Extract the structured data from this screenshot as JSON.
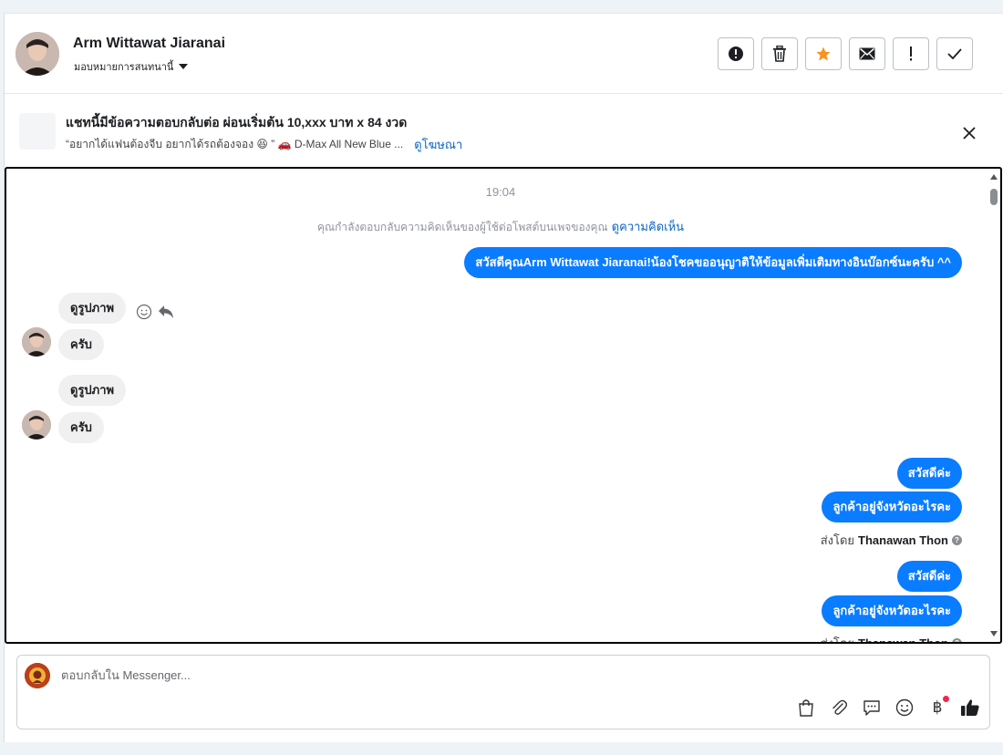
{
  "header": {
    "name": "Arm Wittawat Jiaranai",
    "assign_label": "มอบหมายการสนทนานี้",
    "actions": [
      "alert-icon",
      "trash-icon",
      "star-icon",
      "mail-icon",
      "exclamation-icon",
      "check-icon"
    ],
    "star_color": "#f7931e"
  },
  "ad": {
    "title": "แชทนี้มีข้อความตอบกลับต่อ ผ่อนเริ่มต้น 10,xxx บาท x 84 งวด",
    "subtitle": "“อยากได้แฟนต้องจีบ อยากได้รถต้องจอง 😆 ” 🚗 D-Max All New Blue ...",
    "link": "ดูโฆษณา"
  },
  "chat": {
    "time": "19:04",
    "system_text": "คุณกำลังตอบกลับความคิดเห็นของผู้ใช้ต่อโพสต์บนเพจของคุณ",
    "system_link": "ดูความคิดเห็น",
    "greeting": "สวัสดีคุณArm Wittawat Jiaranai!น้องโชคขออนุญาติให้ข้อมูลเพิ่มเติมทางอินบ๊อกซ์นะครับ ^^",
    "incoming": [
      {
        "image_label": "ดูรูปภาพ",
        "text": "ครับ"
      },
      {
        "image_label": "ดูรูปภาพ",
        "text": "ครับ"
      }
    ],
    "outgoing_groups": [
      {
        "messages": [
          "สวัสดีค่ะ",
          "ลูกค้าอยู่จังหวัดอะไรคะ"
        ],
        "sent_by_prefix": "ส่งโดย",
        "sent_by_name": "Thanawan Thon"
      },
      {
        "messages": [
          "สวัสดีค่ะ",
          "ลูกค้าอยู่จังหวัดอะไรคะ"
        ],
        "sent_by_prefix": "ส่งโดย",
        "sent_by_name": "Thanawan Thon"
      }
    ],
    "accent_color": "#0a7cff"
  },
  "composer": {
    "placeholder": "ตอบกลับใน Messenger...",
    "tools": [
      "bag-icon",
      "paperclip-icon",
      "saved-reply-icon",
      "emoji-icon",
      "baht-icon",
      "like-icon"
    ],
    "baht_symbol": "฿"
  }
}
